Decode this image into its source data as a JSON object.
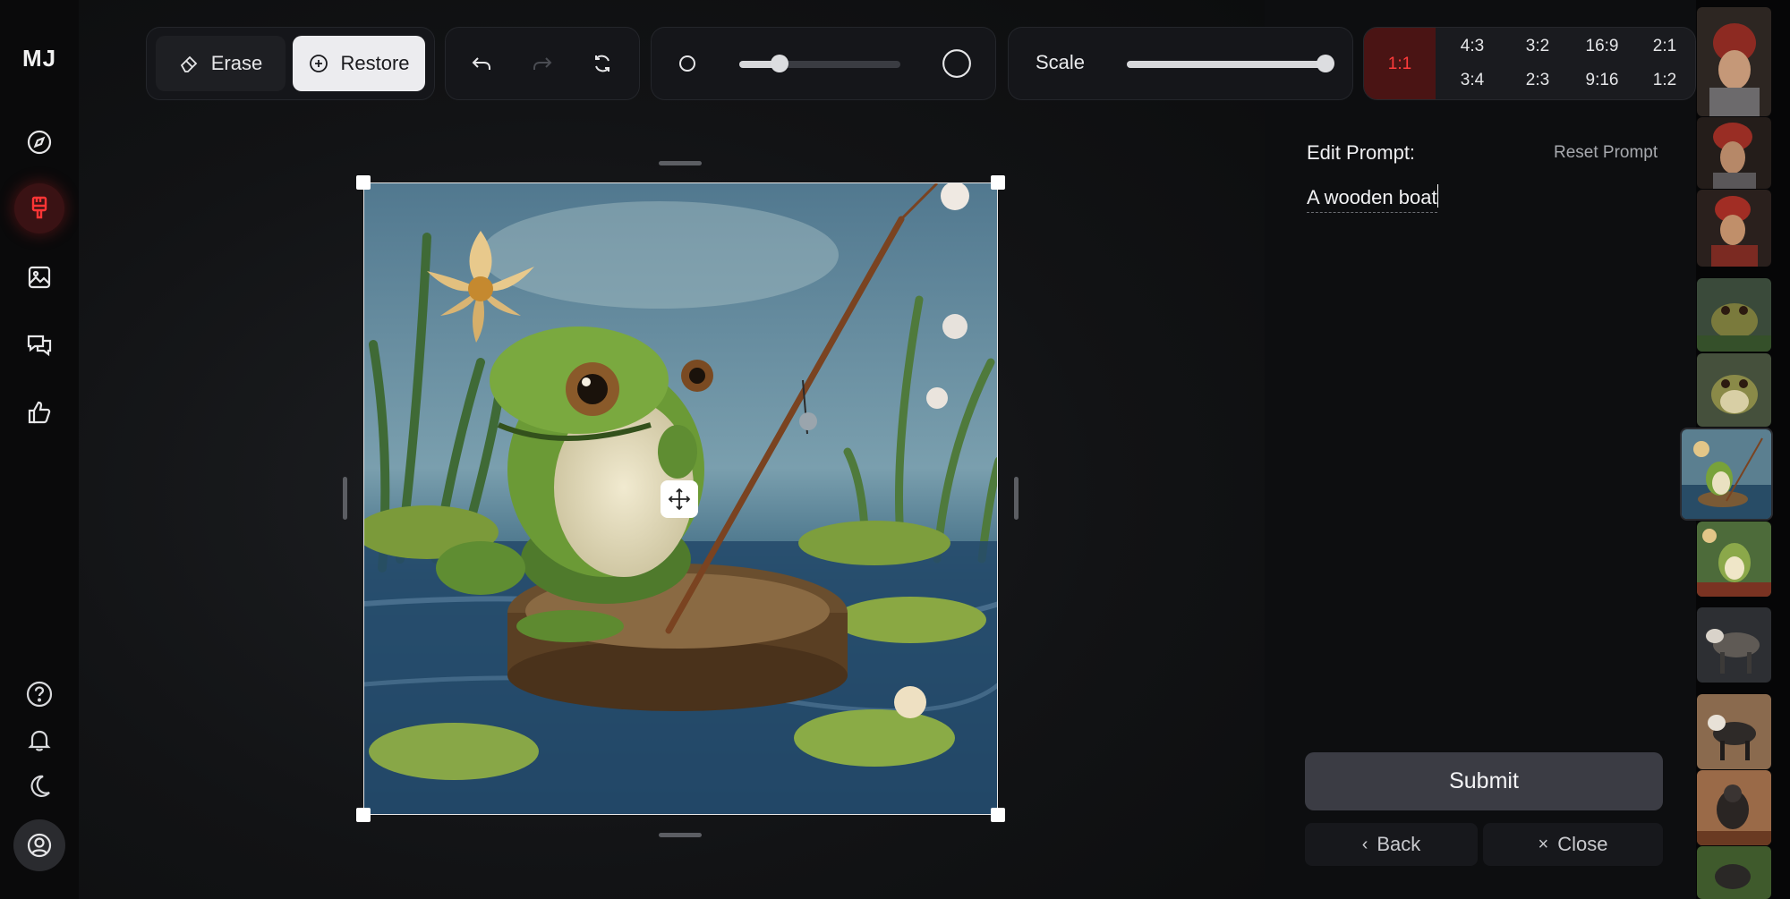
{
  "sidebar": {
    "logo": "MJ",
    "items": [
      {
        "name": "explore",
        "icon": "compass-icon"
      },
      {
        "name": "edit",
        "icon": "brush-icon",
        "active": true
      },
      {
        "name": "images",
        "icon": "image-icon"
      },
      {
        "name": "chat",
        "icon": "chat-icon"
      },
      {
        "name": "likes",
        "icon": "thumbs-up-icon"
      }
    ],
    "bottom": [
      {
        "name": "help",
        "icon": "help-icon"
      },
      {
        "name": "notifications",
        "icon": "bell-icon"
      },
      {
        "name": "theme",
        "icon": "moon-icon"
      },
      {
        "name": "account",
        "icon": "user-circle-icon"
      }
    ]
  },
  "toolbar": {
    "erase_label": "Erase",
    "restore_label": "Restore",
    "brush_size_level": 0.25,
    "scale_label": "Scale",
    "scale_level": 1.0
  },
  "aspect_ratios": {
    "selected": "1:1",
    "options": [
      "4:3",
      "3:2",
      "16:9",
      "2:1",
      "3:4",
      "2:3",
      "9:16",
      "1:2"
    ]
  },
  "editor": {
    "edit_prompt_label": "Edit Prompt:",
    "reset_prompt_label": "Reset Prompt",
    "prompt_value": "A wooden boat",
    "submit_label": "Submit",
    "back_label": "Back",
    "close_label": "Close"
  },
  "colors": {
    "accent_red": "#ff3b3b",
    "active_ratio_bg": "#4a1414"
  }
}
